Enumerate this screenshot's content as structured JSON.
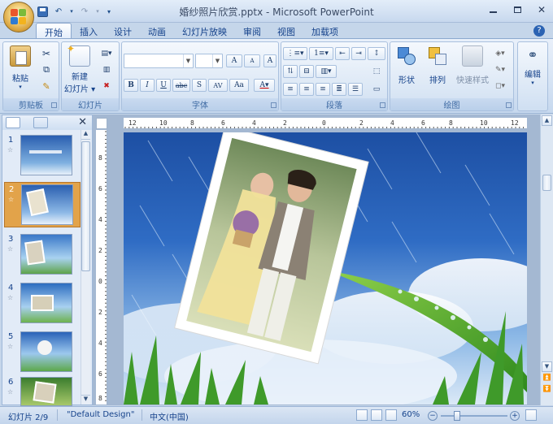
{
  "window": {
    "title": "婚纱照片欣赏.pptx - Microsoft PowerPoint"
  },
  "quick_access": {
    "save": "save-icon",
    "undo": "undo-icon",
    "redo": "redo-icon",
    "customize": "▾"
  },
  "tabs": [
    {
      "label": "开始"
    },
    {
      "label": "插入"
    },
    {
      "label": "设计"
    },
    {
      "label": "动画"
    },
    {
      "label": "幻灯片放映"
    },
    {
      "label": "审阅"
    },
    {
      "label": "视图"
    },
    {
      "label": "加载项"
    }
  ],
  "ribbon": {
    "clipboard": {
      "label": "剪贴板",
      "paste": "粘贴"
    },
    "slides": {
      "label": "幻灯片",
      "new_slide_line1": "新建",
      "new_slide_line2": "幻灯片 ▾"
    },
    "font": {
      "label": "字体",
      "font_name": "",
      "font_size": "",
      "bold": "B",
      "italic": "I",
      "underline": "U",
      "strike": "abc",
      "shadow": "S",
      "spacing": "AV",
      "case": "Aa",
      "grow": "A",
      "shrink": "A",
      "clear": "A"
    },
    "paragraph": {
      "label": "段落"
    },
    "drawing": {
      "label": "绘图",
      "shapes": "形状",
      "arrange": "排列",
      "quick_styles": "快速样式"
    },
    "editing": {
      "label": "编辑"
    }
  },
  "ruler": {
    "h_ticks": [
      "12",
      "10",
      "8",
      "6",
      "4",
      "2",
      "0",
      "2",
      "4",
      "6",
      "8",
      "10",
      "12"
    ],
    "v_ticks": [
      "8",
      "6",
      "4",
      "2",
      "0",
      "2",
      "4",
      "6",
      "8"
    ]
  },
  "slides_panel": {
    "items": [
      {
        "num": "1"
      },
      {
        "num": "2"
      },
      {
        "num": "3"
      },
      {
        "num": "4"
      },
      {
        "num": "5"
      },
      {
        "num": "6"
      }
    ],
    "selected": "2"
  },
  "status": {
    "slide_info": "幻灯片 2/9",
    "theme": "\"Default Design\"",
    "language": "中文(中国)",
    "zoom": "60%"
  },
  "colors": {
    "accent": "#15428b",
    "selected_thumb": "#e2a34a"
  }
}
